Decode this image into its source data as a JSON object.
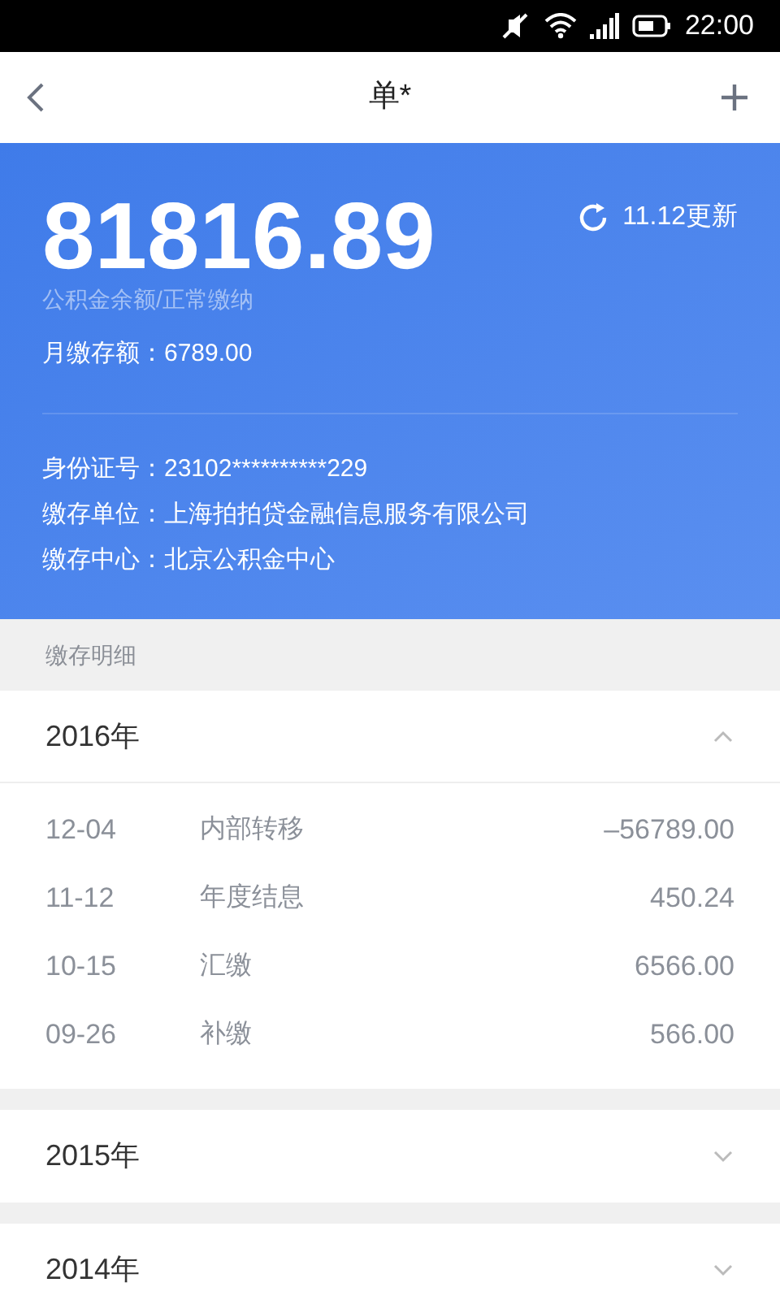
{
  "status_bar": {
    "time": "22:00"
  },
  "header": {
    "title": "单*"
  },
  "summary": {
    "balance": "81816.89",
    "update": "11.12更新",
    "balance_label": "公积金余额/正常缴纳",
    "monthly": "月缴存额：6789.00",
    "info": [
      "身份证号：23102**********229",
      "缴存单位：上海拍拍贷金融信息服务有限公司",
      "缴存中心：北京公积金中心"
    ]
  },
  "section_title": "缴存明细",
  "years": [
    {
      "label": "2016年",
      "expanded": true,
      "records": [
        {
          "date": "12-04",
          "type": "内部转移",
          "amount": "–56789.00"
        },
        {
          "date": "11-12",
          "type": "年度结息",
          "amount": "450.24"
        },
        {
          "date": "10-15",
          "type": "汇缴",
          "amount": "6566.00"
        },
        {
          "date": "09-26",
          "type": "补缴",
          "amount": "566.00"
        }
      ]
    },
    {
      "label": "2015年",
      "expanded": false
    },
    {
      "label": "2014年",
      "expanded": false
    }
  ]
}
